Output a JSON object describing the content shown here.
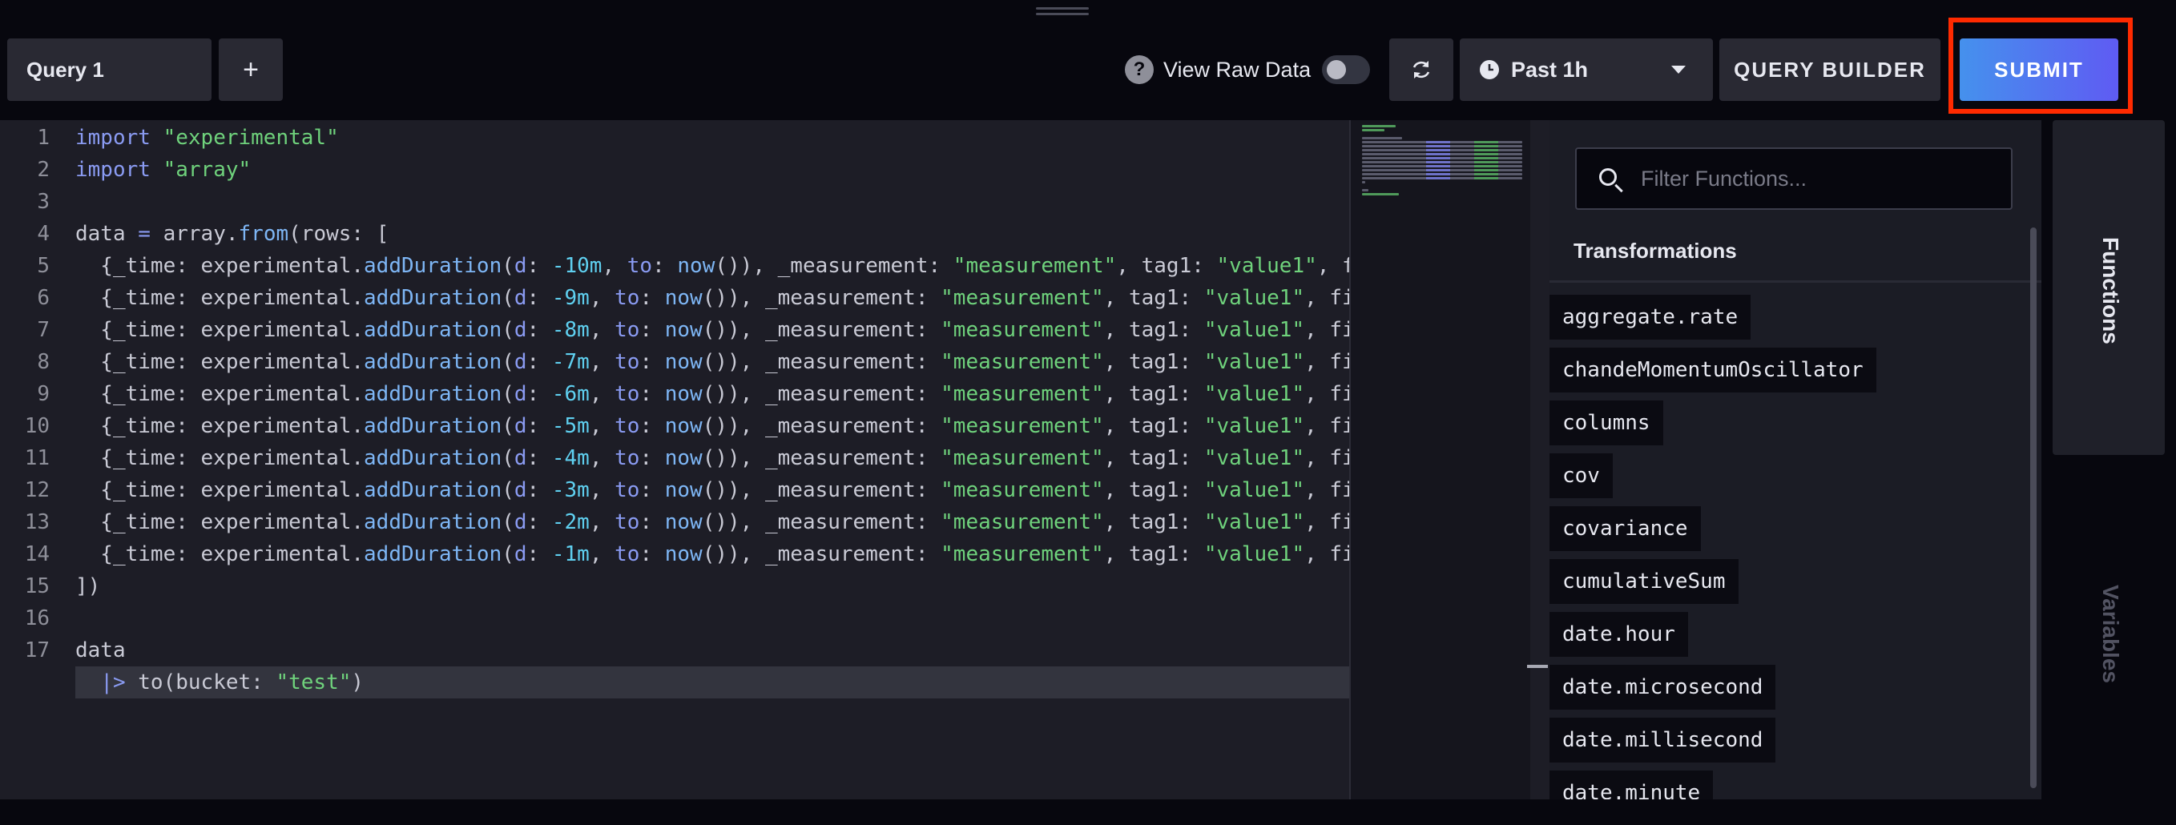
{
  "toolbar": {
    "query_tab_label": "Query 1",
    "add_tab_label": "+",
    "help_glyph": "?",
    "view_raw_label": "View Raw Data",
    "view_raw_on": false,
    "refresh_icon": "refresh-icon",
    "time_range_label": "Past 1h",
    "clock_icon": "clock-icon",
    "query_builder_label": "QUERY BUILDER",
    "submit_label": "SUBMIT"
  },
  "editor": {
    "current_line": 18,
    "lines": [
      "import \"experimental\"",
      "import \"array\"",
      "",
      "data = array.from(rows: [",
      "  {_time: experimental.addDuration(d: -10m, to: now()), _measurement: \"measurement\", tag1: \"value1\", f",
      "  {_time: experimental.addDuration(d: -9m, to: now()), _measurement: \"measurement\", tag1: \"value1\", fi",
      "  {_time: experimental.addDuration(d: -8m, to: now()), _measurement: \"measurement\", tag1: \"value1\", fi",
      "  {_time: experimental.addDuration(d: -7m, to: now()), _measurement: \"measurement\", tag1: \"value1\", fi",
      "  {_time: experimental.addDuration(d: -6m, to: now()), _measurement: \"measurement\", tag1: \"value1\", fi",
      "  {_time: experimental.addDuration(d: -5m, to: now()), _measurement: \"measurement\", tag1: \"value1\", fi",
      "  {_time: experimental.addDuration(d: -4m, to: now()), _measurement: \"measurement\", tag1: \"value1\", fi",
      "  {_time: experimental.addDuration(d: -3m, to: now()), _measurement: \"measurement\", tag1: \"value1\", fi",
      "  {_time: experimental.addDuration(d: -2m, to: now()), _measurement: \"measurement\", tag1: \"value1\", fi",
      "  {_time: experimental.addDuration(d: -1m, to: now()), _measurement: \"measurement\", tag1: \"value1\", fi",
      "])",
      "",
      "data",
      "  |> to(bucket: \"test\")"
    ]
  },
  "functions_panel": {
    "search_placeholder": "Filter Functions...",
    "section_title": "Transformations",
    "items": [
      "aggregate.rate",
      "chandeMomentumOscillator",
      "columns",
      "cov",
      "covariance",
      "cumulativeSum",
      "date.hour",
      "date.microsecond",
      "date.millisecond",
      "date.minute"
    ]
  },
  "side_tabs": {
    "functions_label": "Functions",
    "variables_label": "Variables"
  },
  "colors": {
    "background": "#07070e",
    "editor_bg": "#1d1d26",
    "panel_bg": "#1b1c25",
    "submit_gradient_start": "#4591ed",
    "submit_gradient_end": "#5f5bf3",
    "highlight": "#ff2a00",
    "string": "#6fd27c",
    "keyword": "#8a9bf2"
  }
}
